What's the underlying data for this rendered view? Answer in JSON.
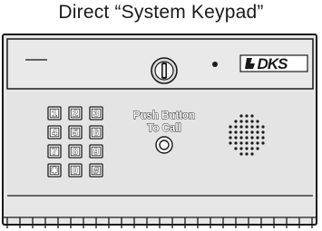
{
  "caption": "Direct “System Keypad”",
  "panel": {
    "brand_logo_text": "DKS",
    "button_label_line1": "Push Button",
    "button_label_line2": "To Call"
  },
  "keypad": {
    "keys": [
      "1",
      "2",
      "3",
      "4",
      "5",
      "6",
      "7",
      "8",
      "9",
      "✱",
      "0",
      "#"
    ]
  },
  "colors": {
    "panel_fill": "#e6e6e6",
    "outline": "#1a1a1a"
  },
  "icons": [
    "key-lock-icon",
    "indicator-light-icon",
    "call-button-icon",
    "speaker-grille-icon",
    "dks-logo-icon"
  ]
}
